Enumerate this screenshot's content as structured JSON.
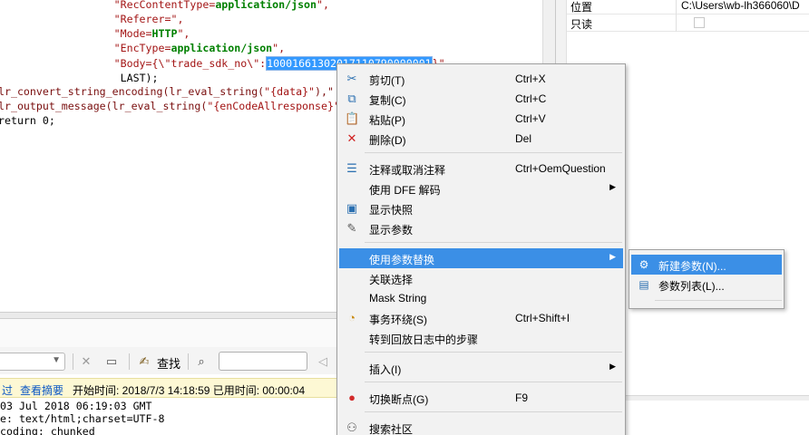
{
  "editor": {
    "lines": [
      {
        "indent": "                  ",
        "parts": [
          {
            "t": "\"RecContentType=",
            "c": "str"
          },
          {
            "t": "application/json",
            "c": "kw"
          },
          {
            "t": "\",",
            "c": "str"
          }
        ]
      },
      {
        "indent": "                  ",
        "parts": [
          {
            "t": "\"Referer=\",",
            "c": "str"
          }
        ]
      },
      {
        "indent": "                  ",
        "parts": [
          {
            "t": "\"Mode=",
            "c": "str"
          },
          {
            "t": "HTTP",
            "c": "kw"
          },
          {
            "t": "\",",
            "c": "str"
          }
        ]
      },
      {
        "indent": "                  ",
        "parts": [
          {
            "t": "\"EncType=",
            "c": "str"
          },
          {
            "t": "application/json",
            "c": "kw"
          },
          {
            "t": "\",",
            "c": "str"
          }
        ]
      },
      {
        "indent": "                  ",
        "parts": [
          {
            "t": "\"Body={\\\"trade_sdk_no\\\":",
            "c": "str"
          },
          {
            "t": "10001661302017110790000001",
            "c": "sel"
          },
          {
            "t": "}\",",
            "c": "str"
          }
        ]
      },
      {
        "indent": "                   ",
        "parts": [
          {
            "t": "LAST);",
            "c": "plain"
          }
        ]
      },
      {
        "indent": "",
        "parts": [
          {
            "t": "lr_convert_string_encoding(lr_eval_string(",
            "c": "fn"
          },
          {
            "t": "\"{data}\"",
            "c": "str"
          },
          {
            "t": "),\"",
            "c": "fn"
          }
        ]
      },
      {
        "indent": "",
        "parts": [
          {
            "t": "lr_output_message(lr_eval_string(",
            "c": "fn"
          },
          {
            "t": "\"{enCodeAllresponse}\"",
            "c": "str"
          }
        ]
      },
      {
        "indent": "",
        "parts": [
          {
            "t": "return 0;",
            "c": "plain"
          }
        ]
      }
    ]
  },
  "properties": {
    "rows": [
      {
        "name": "位置",
        "value": "C:\\Users\\wb-lh366060\\D"
      },
      {
        "name": "只读",
        "value": ""
      }
    ]
  },
  "toolbar": {
    "find_label": "查找"
  },
  "info_bar": {
    "link1": "过",
    "link2": "查看摘要",
    "text": "开始时间: 2018/7/3 14:18:59 已用时间: 00:00:04"
  },
  "response": {
    "lines": [
      "03 Jul 2018 06:19:03 GMT",
      "e: text/html;charset=UTF-8",
      "coding: chunked"
    ]
  },
  "context_menu": {
    "items": [
      {
        "icon": "scissors-icon",
        "glyph": "✂",
        "color": "#2a6fb0",
        "label": "剪切(T)",
        "shortcut": "Ctrl+X"
      },
      {
        "icon": "copy-icon",
        "glyph": "⧉",
        "color": "#2a6fb0",
        "label": "复制(C)",
        "shortcut": "Ctrl+C"
      },
      {
        "icon": "paste-icon",
        "glyph": "📋",
        "color": "#8a6a2a",
        "label": "粘贴(P)",
        "shortcut": "Ctrl+V"
      },
      {
        "icon": "delete-icon",
        "glyph": "✕",
        "color": "#d02020",
        "label": "删除(D)",
        "shortcut": "Del"
      },
      {
        "icon": "comment-icon",
        "glyph": "☰",
        "color": "#2a6fb0",
        "label": "注释或取消注释",
        "shortcut": "Ctrl+OemQuestion"
      },
      {
        "icon": "",
        "glyph": "",
        "color": "",
        "label": "使用 DFE 解码",
        "shortcut": "",
        "submenu": true
      },
      {
        "icon": "snapshot-icon",
        "glyph": "▣",
        "color": "#2a6fb0",
        "label": "显示快照",
        "shortcut": ""
      },
      {
        "icon": "params-icon",
        "glyph": "✎",
        "color": "#555555",
        "label": "显示参数",
        "shortcut": ""
      },
      {
        "icon": "",
        "glyph": "",
        "color": "",
        "label": "使用参数替换",
        "shortcut": "",
        "submenu": true,
        "active": true
      },
      {
        "icon": "",
        "glyph": "",
        "color": "",
        "label": "关联选择",
        "shortcut": ""
      },
      {
        "icon": "",
        "glyph": "",
        "color": "",
        "label": "Mask String",
        "shortcut": ""
      },
      {
        "icon": "transaction-icon",
        "glyph": "◔",
        "color": "#c98a10",
        "label": "事务环绕(S)",
        "shortcut": "Ctrl+Shift+I"
      },
      {
        "icon": "",
        "glyph": "",
        "color": "",
        "label": "转到回放日志中的步骤",
        "shortcut": ""
      },
      {
        "icon": "",
        "glyph": "",
        "color": "",
        "label": "插入(I)",
        "shortcut": "",
        "submenu": true
      },
      {
        "icon": "breakpoint-icon",
        "glyph": "●",
        "color": "#d22a2a",
        "label": "切换断点(G)",
        "shortcut": "F9"
      },
      {
        "icon": "community-icon",
        "glyph": "⚇",
        "color": "#555555",
        "label": "搜索社区",
        "shortcut": ""
      }
    ]
  },
  "sub_menu": {
    "items": [
      {
        "icon": "new-param-icon",
        "glyph": "⚙",
        "label": "新建参数(N)...",
        "active": true
      },
      {
        "icon": "param-list-icon",
        "glyph": "▤",
        "label": "参数列表(L)...",
        "active": false
      }
    ]
  },
  "colors": {
    "menu_highlight": "#3b8fe6",
    "code_string": "#a31515",
    "code_keyword": "#008000",
    "info_bar_bg": "#fdf8d4"
  }
}
